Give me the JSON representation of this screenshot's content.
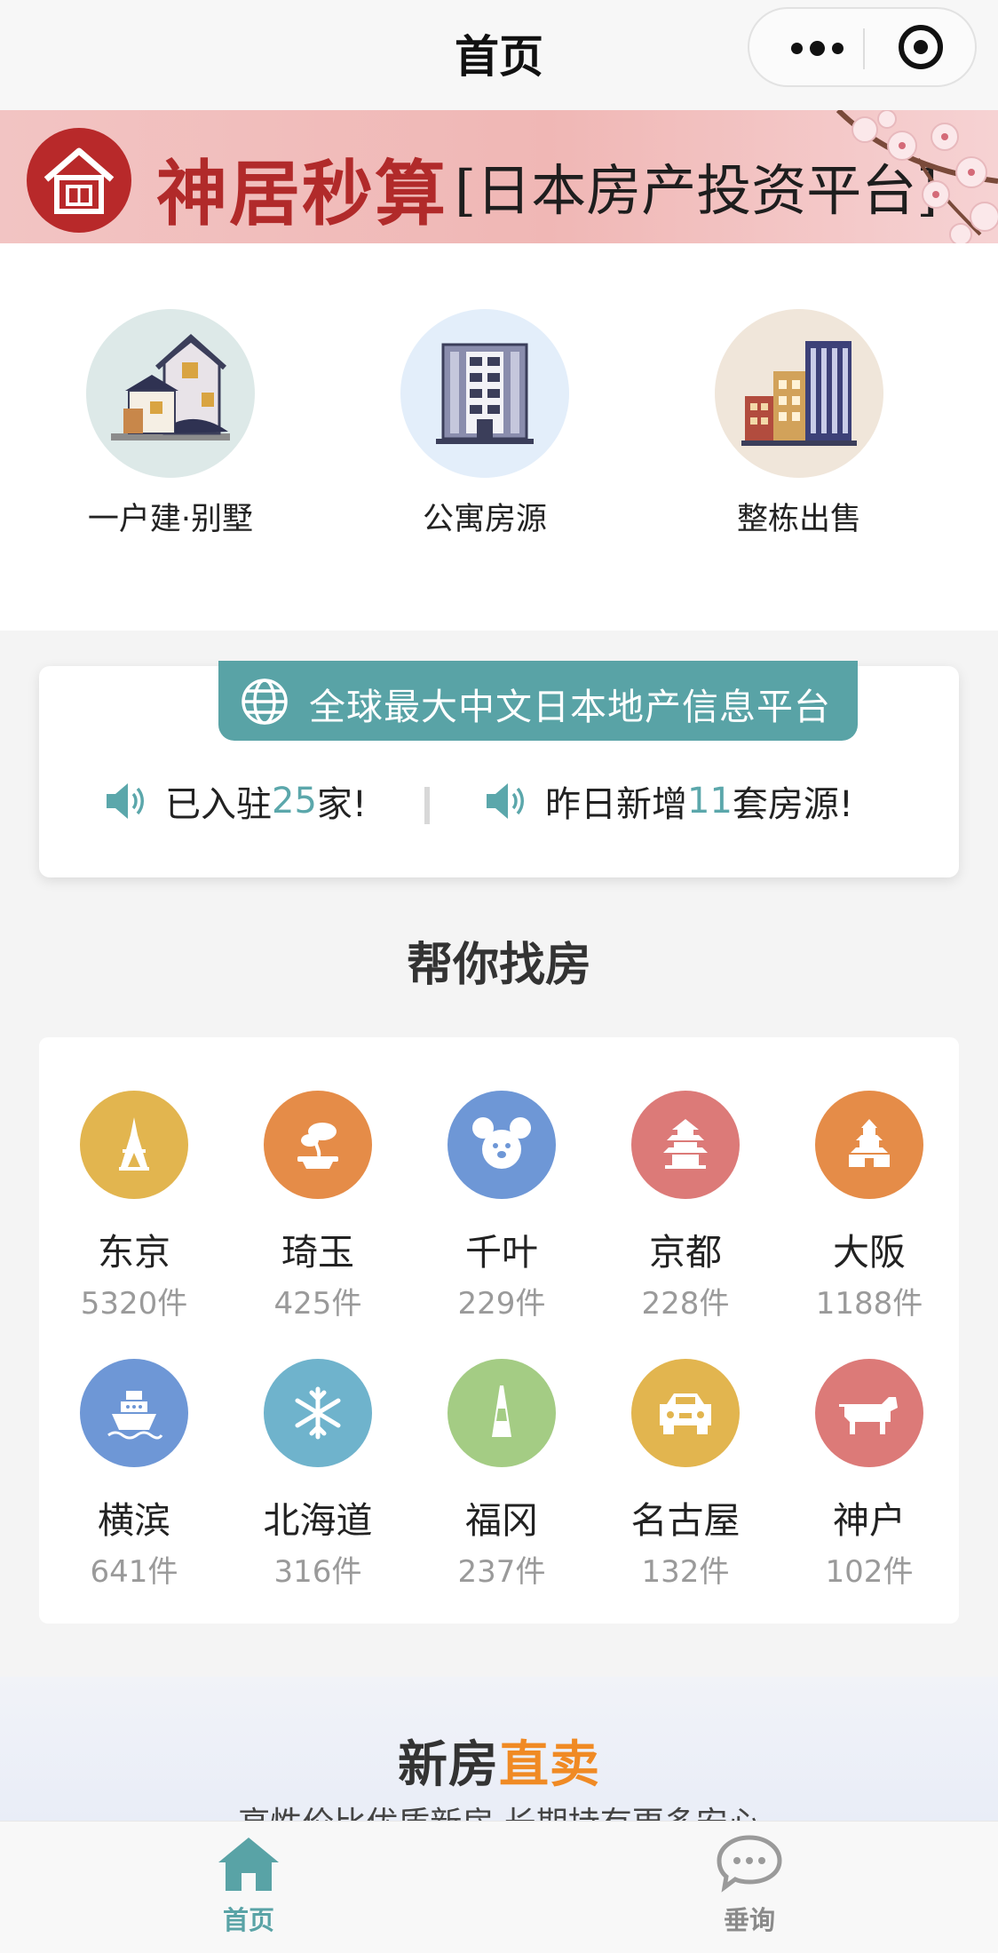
{
  "nav": {
    "title": "首页"
  },
  "banner": {
    "brand": "神居秒算",
    "tagline": "[日本房产投资平台]"
  },
  "categories": [
    {
      "label": "一户建·别墅",
      "icon": "house-icon"
    },
    {
      "label": "公寓房源",
      "icon": "apartment-building-icon"
    },
    {
      "label": "整栋出售",
      "icon": "city-buildings-icon"
    }
  ],
  "info": {
    "headline": "全球最大中文日本地产信息平台",
    "stat1": {
      "pre": "已入驻",
      "num": "25",
      "post": "家!"
    },
    "stat2": {
      "pre": "昨日新增",
      "num": "11",
      "post": "套房源!"
    }
  },
  "find": {
    "title": "帮你找房",
    "cities": [
      {
        "name": "东京",
        "count": "5320件",
        "icon": "tokyo-tower-icon",
        "color": "#e2b54f"
      },
      {
        "name": "琦玉",
        "count": "425件",
        "icon": "bonsai-icon",
        "color": "#e58c48"
      },
      {
        "name": "千叶",
        "count": "229件",
        "icon": "mouse-face-icon",
        "color": "#6e97d6"
      },
      {
        "name": "京都",
        "count": "228件",
        "icon": "pagoda-icon",
        "color": "#dc7a78"
      },
      {
        "name": "大阪",
        "count": "1188件",
        "icon": "castle-icon",
        "color": "#e58c48"
      },
      {
        "name": "横滨",
        "count": "641件",
        "icon": "ship-icon",
        "color": "#6e97d6"
      },
      {
        "name": "北海道",
        "count": "316件",
        "icon": "snowflake-icon",
        "color": "#6fb3cc"
      },
      {
        "name": "福冈",
        "count": "237件",
        "icon": "tower-icon",
        "color": "#a4cc84"
      },
      {
        "name": "名古屋",
        "count": "132件",
        "icon": "car-icon",
        "color": "#e2b54f"
      },
      {
        "name": "神户",
        "count": "102件",
        "icon": "cow-icon",
        "color": "#dc7a78"
      }
    ]
  },
  "promo": {
    "title_a": "新房",
    "title_b": "直卖",
    "subtitle": "高性价比优质新房 长期持有更多安心"
  },
  "tabs": [
    {
      "label": "首页",
      "icon": "home-icon",
      "active": true
    },
    {
      "label": "垂询",
      "icon": "chat-bubble-icon",
      "active": false
    }
  ],
  "colors": {
    "accent": "#59a3a6",
    "brand_red": "#b12a2a"
  }
}
